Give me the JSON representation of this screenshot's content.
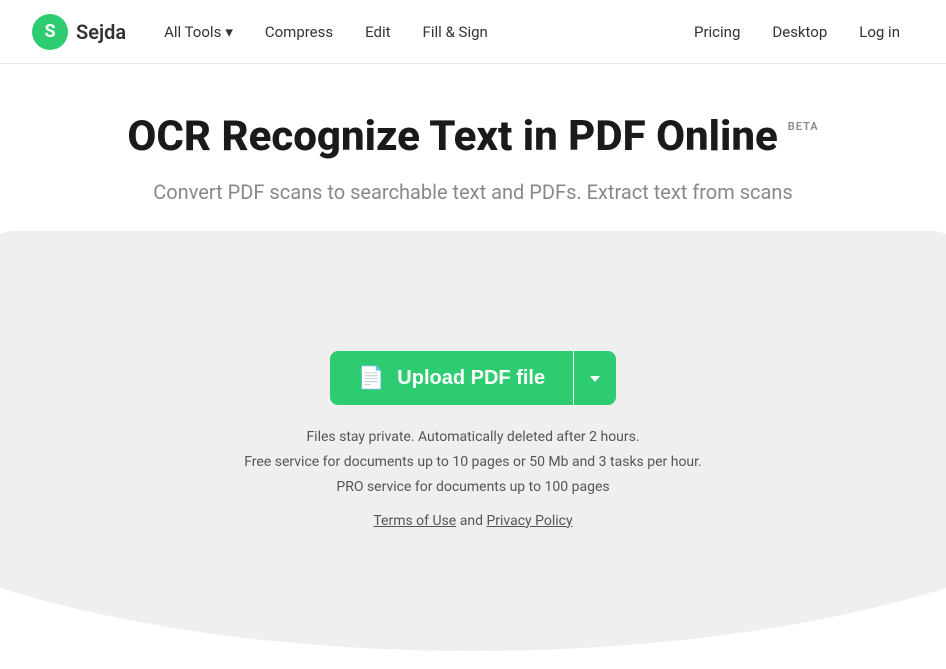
{
  "nav": {
    "logo_letter": "S",
    "logo_name": "Sejda",
    "links": [
      {
        "label": "All Tools",
        "has_dropdown": true
      },
      {
        "label": "Compress"
      },
      {
        "label": "Edit"
      },
      {
        "label": "Fill & Sign"
      }
    ],
    "right_links": [
      {
        "label": "Pricing"
      },
      {
        "label": "Desktop"
      },
      {
        "label": "Log in"
      }
    ]
  },
  "hero": {
    "title": "OCR Recognize Text in PDF Online",
    "beta": "BETA",
    "subtitle": "Convert PDF scans to searchable text and PDFs. Extract text from scans",
    "upload_btn": "Upload PDF file",
    "info_line1": "Files stay private. Automatically deleted after 2 hours.",
    "info_line2": "Free service for documents up to 10 pages or 50 Mb and 3 tasks per hour.",
    "info_line3": "PRO service for documents up to 100 pages",
    "terms_label": "Terms of Use",
    "and_label": "and",
    "privacy_label": "Privacy Policy"
  }
}
